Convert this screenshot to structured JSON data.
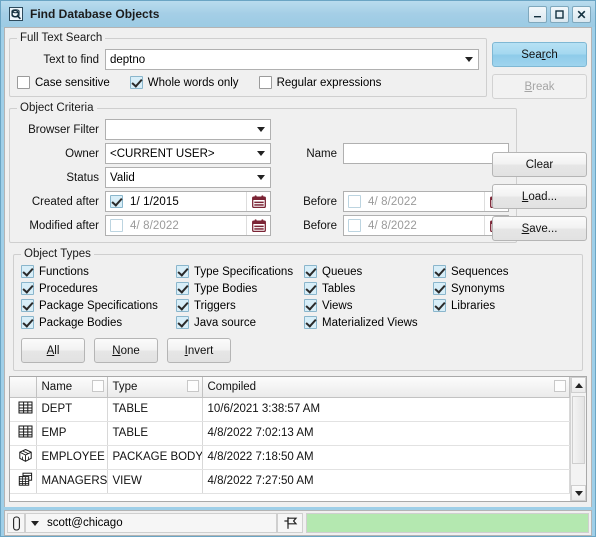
{
  "window": {
    "title": "Find Database Objects",
    "icon": "find-database-icon",
    "controls": {
      "minimize": "minimize-icon",
      "maximize": "maximize-icon",
      "close": "close-icon"
    }
  },
  "full_text_search": {
    "legend": "Full Text Search",
    "text_to_find_label": "Text to find",
    "text_to_find_value": "deptno",
    "options": [
      {
        "label": "Case sensitive",
        "checked": false
      },
      {
        "label": "Whole words only",
        "checked": true
      },
      {
        "label": "Regular expressions",
        "checked": false
      }
    ]
  },
  "object_criteria": {
    "legend": "Object Criteria",
    "browser_filter_label": "Browser Filter",
    "browser_filter_value": "",
    "owner_label": "Owner",
    "owner_value": "<CURRENT USER>",
    "name_label": "Name",
    "name_value": "",
    "status_label": "Status",
    "status_value": "Valid",
    "created_after_label": "Created after",
    "created_after_value": "1/  1/2015",
    "created_after_checked": true,
    "created_before_label": "Before",
    "created_before_value": "4/  8/2022",
    "created_before_checked": false,
    "modified_after_label": "Modified after",
    "modified_after_value": "4/  8/2022",
    "modified_after_checked": false,
    "modified_before_label": "Before",
    "modified_before_value": "4/  8/2022",
    "modified_before_checked": false
  },
  "object_types": {
    "legend": "Object Types",
    "items": [
      {
        "label": "Functions",
        "checked": true
      },
      {
        "label": "Type Specifications",
        "checked": true
      },
      {
        "label": "Queues",
        "checked": true
      },
      {
        "label": "Sequences",
        "checked": true
      },
      {
        "label": "Procedures",
        "checked": true
      },
      {
        "label": "Type Bodies",
        "checked": true
      },
      {
        "label": "Tables",
        "checked": true
      },
      {
        "label": "Synonyms",
        "checked": true
      },
      {
        "label": "Package Specifications",
        "checked": true
      },
      {
        "label": "Triggers",
        "checked": true
      },
      {
        "label": "Views",
        "checked": true
      },
      {
        "label": "Libraries",
        "checked": true
      },
      {
        "label": "Package Bodies",
        "checked": true
      },
      {
        "label": "Java source",
        "checked": true
      },
      {
        "label": "Materialized Views",
        "checked": true
      },
      {
        "label": "",
        "checked": false
      }
    ],
    "buttons": [
      {
        "pre": "",
        "mn": "A",
        "post": "ll"
      },
      {
        "pre": "",
        "mn": "N",
        "post": "one"
      },
      {
        "pre": "",
        "mn": "I",
        "post": "nvert"
      }
    ]
  },
  "actions": {
    "search": {
      "pre": "Sea",
      "mn": "r",
      "post": "ch"
    },
    "break": {
      "pre": "",
      "mn": "B",
      "post": "reak"
    },
    "clear": {
      "pre": "Clear",
      "mn": "",
      "post": ""
    },
    "load": {
      "pre": "",
      "mn": "L",
      "post": "oad..."
    },
    "save": {
      "pre": "",
      "mn": "S",
      "post": "ave..."
    }
  },
  "results": {
    "columns": [
      "",
      "Name",
      "Type",
      "Compiled"
    ],
    "rows": [
      {
        "icon": "table-icon",
        "name": "DEPT",
        "type": "TABLE",
        "compiled": "10/6/2021 3:38:57 AM"
      },
      {
        "icon": "table-icon",
        "name": "EMP",
        "type": "TABLE",
        "compiled": "4/8/2022 7:02:13 AM"
      },
      {
        "icon": "package-body-icon",
        "name": "EMPLOYEE",
        "type": "PACKAGE BODY",
        "compiled": "4/8/2022 7:18:50 AM"
      },
      {
        "icon": "view-icon",
        "name": "MANAGERS",
        "type": "VIEW",
        "compiled": "4/8/2022 7:27:50 AM"
      }
    ]
  },
  "statusbar": {
    "lock_icon": "lock-icon",
    "connection": "scott@chicago",
    "pin_icon": "pin-icon",
    "progress_color": "#b4e8b0"
  },
  "colors": {
    "titlebar": "#a4cee6",
    "window_border": "#9fcfe8",
    "primary_button": "#a4d8f0",
    "calendar_icon": "#7b2435",
    "progress": "#b4e8b0"
  }
}
